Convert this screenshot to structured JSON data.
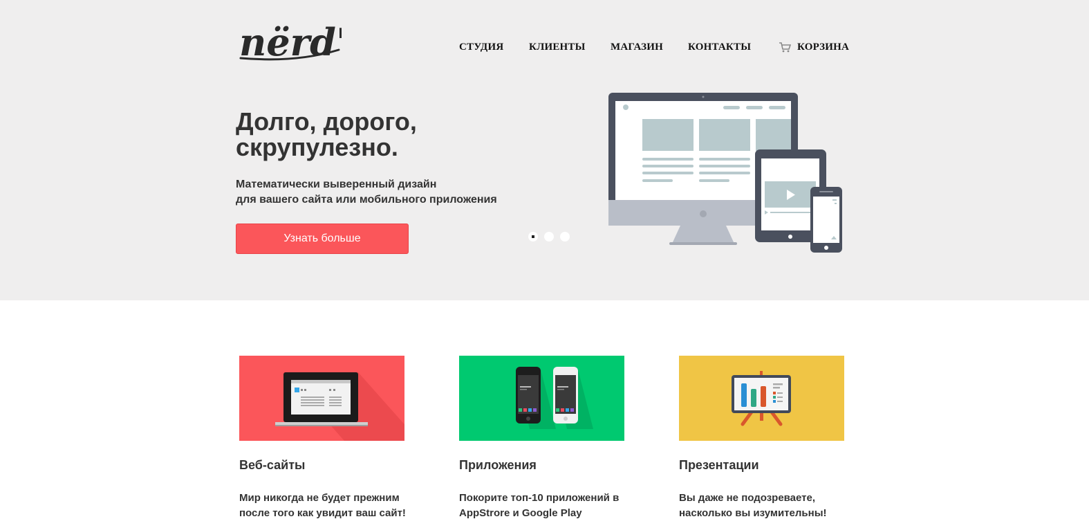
{
  "brand": {
    "logo_text": "nërd's"
  },
  "nav": {
    "items": [
      "СТУДИЯ",
      "КЛИЕНТЫ",
      "МАГАЗИН",
      "КОНТАКТЫ"
    ],
    "cart_label": "КОРЗИНА",
    "cart_icon": "cart-icon"
  },
  "hero": {
    "headline_lines": [
      "Долго, дорого,",
      "скрупулезно."
    ],
    "subtitle_lines": [
      "Математически выверенный дизайн",
      "для вашего сайта или мобильного приложения"
    ],
    "cta_label": "Узнать больше",
    "slider": {
      "count": 3,
      "active": 1
    },
    "illustration": "devices-illustration"
  },
  "features": [
    {
      "title": "Веб-сайты",
      "text_lines": [
        "Мир никогда не будет прежним",
        "после того как увидит ваш сайт!"
      ],
      "color": "#fb565a",
      "illustration": "laptop-illustration"
    },
    {
      "title": "Приложения",
      "text_lines": [
        "Покорите топ-10 приложений в",
        "AppStrore и Google Play"
      ],
      "color": "#00c970",
      "illustration": "phones-illustration"
    },
    {
      "title": "Презентации",
      "text_lines": [
        "Вы даже не подозреваете,",
        "насколько вы изумительны!"
      ],
      "color": "#f0c545",
      "illustration": "presentation-board-illustration"
    }
  ],
  "colors": {
    "hero_bg": "#efeeee",
    "accent": "#fb565a",
    "device_frame": "#4a505e",
    "screen_block": "#b8cacd"
  }
}
